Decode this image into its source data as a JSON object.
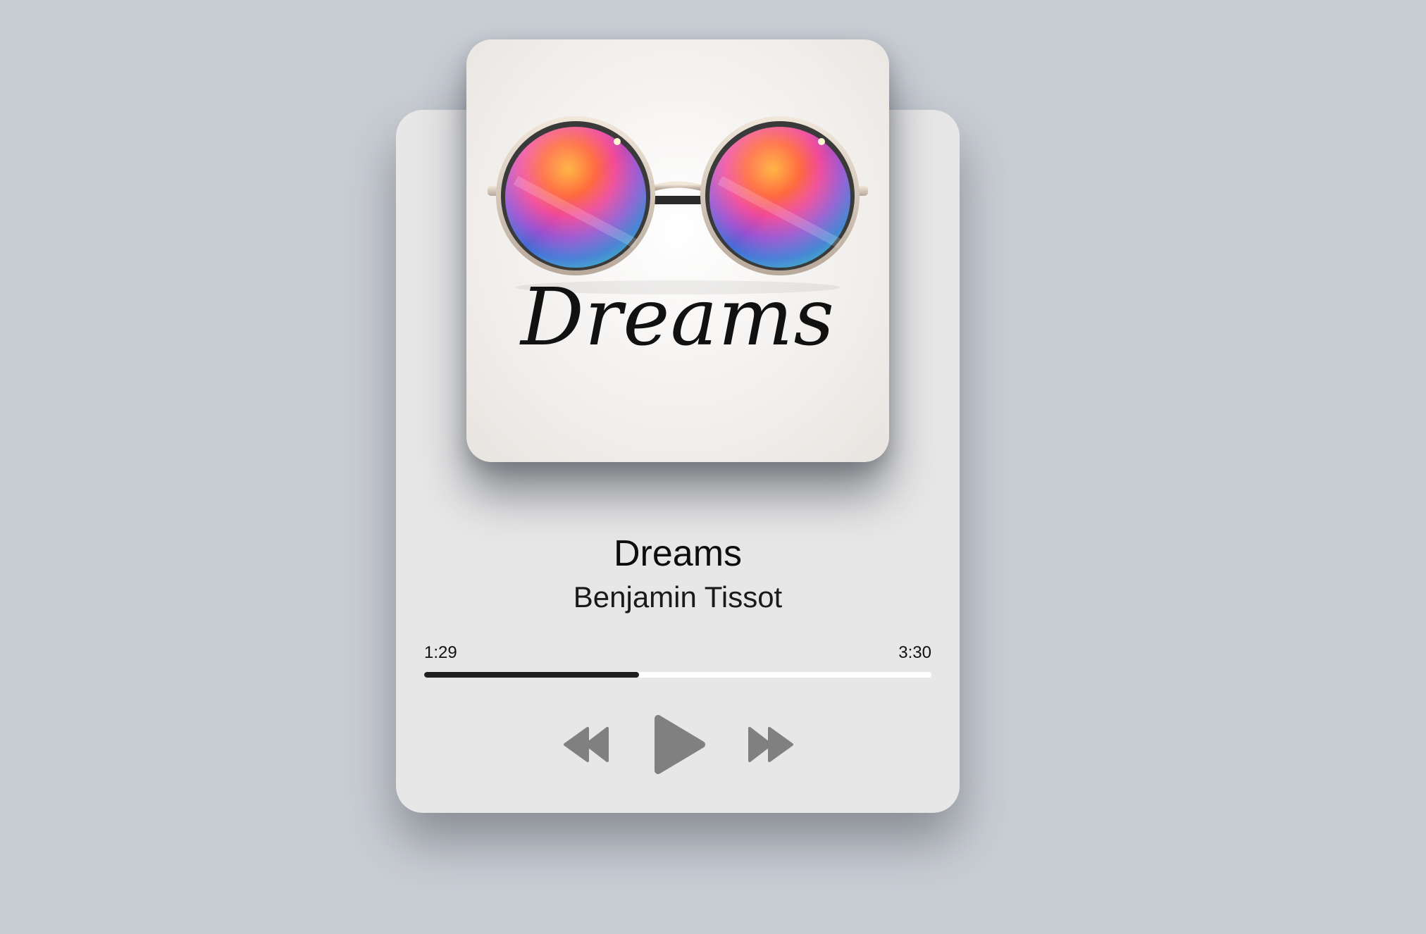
{
  "track": {
    "title": "Dreams",
    "artist": "Benjamin Tissot",
    "album_art_text": "Dreams"
  },
  "playback": {
    "current_time": "1:29",
    "total_time": "3:30",
    "progress": 0.424
  },
  "controls": {
    "rewind_icon": "rewind-icon",
    "play_icon": "play-icon",
    "forward_icon": "fast-forward-icon"
  },
  "colors": {
    "background": "#c9cdd4",
    "card": "#e7e7e8",
    "progress_fill": "#1f1f1f",
    "progress_track": "#ffffff",
    "control": "#808080"
  }
}
